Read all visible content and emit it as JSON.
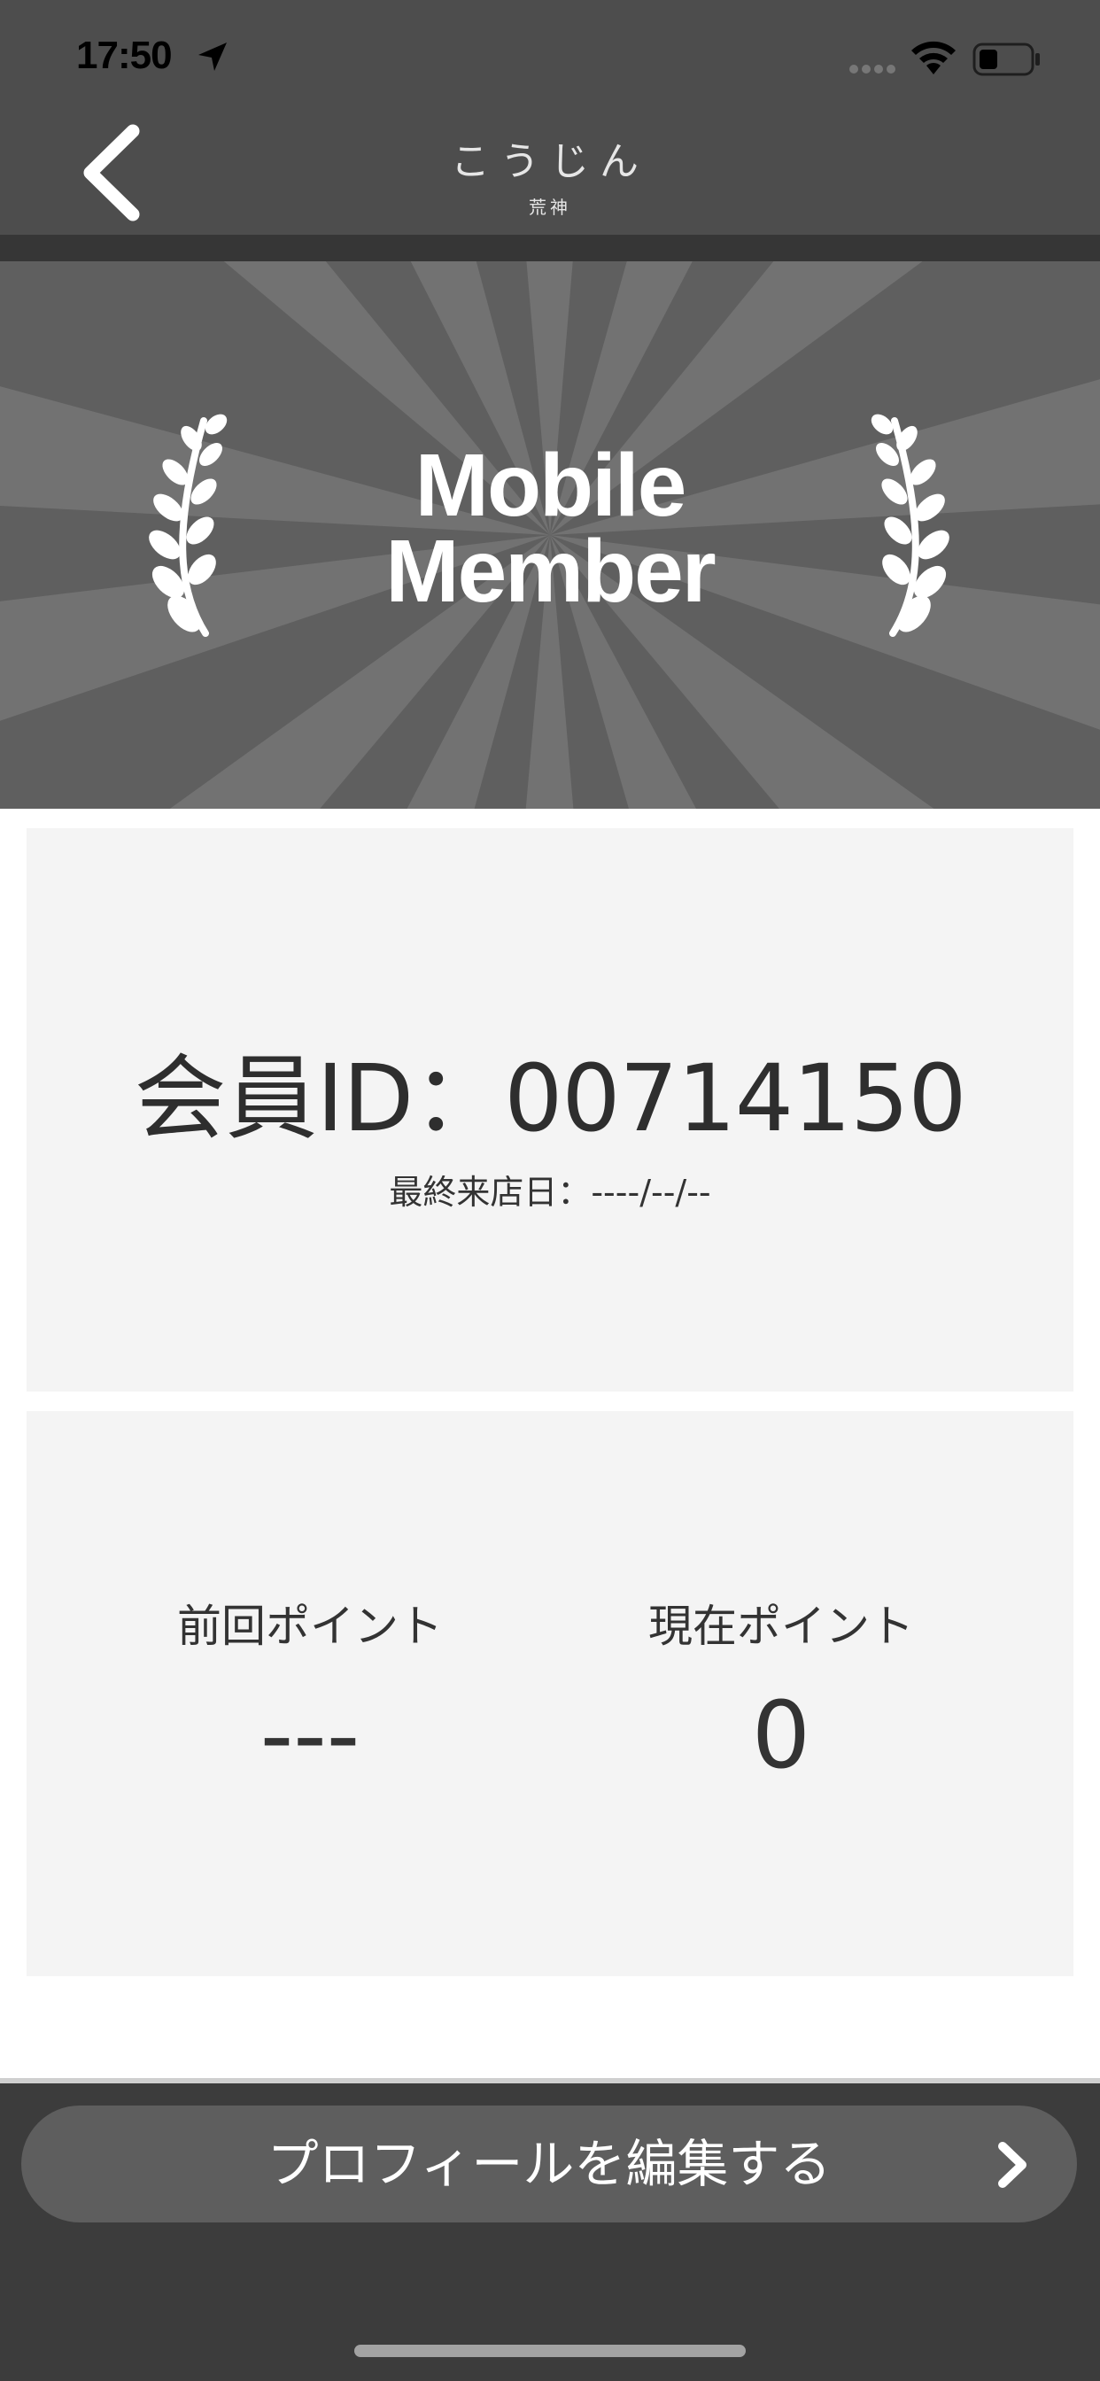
{
  "status": {
    "time": "17:50"
  },
  "header": {
    "logo_main": "こうじん",
    "logo_sub": "荒神"
  },
  "hero": {
    "title_line1": "Mobile",
    "title_line2": "Member"
  },
  "member": {
    "id_text": "会員ID：00714150",
    "last_visit": "最終来店日：----/--/--"
  },
  "points": {
    "previous_label": "前回ポイント",
    "previous_value": "---",
    "current_label": "現在ポイント",
    "current_value": "0"
  },
  "footer": {
    "edit_profile_label": "プロフィールを編集する"
  },
  "icons": {
    "back": "chevron-left-icon",
    "location": "location-arrow-icon",
    "wifi": "wifi-icon",
    "battery": "battery-icon",
    "signal": "cellular-signal-icon",
    "laurel": "laurel-icon",
    "chevron": "chevron-right-icon"
  },
  "colors": {
    "header_bg": "#4d4d4d",
    "hero_bg": "#5f5f5f",
    "panel_bg": "#f4f4f4",
    "button_bg": "#5e5e5e"
  }
}
